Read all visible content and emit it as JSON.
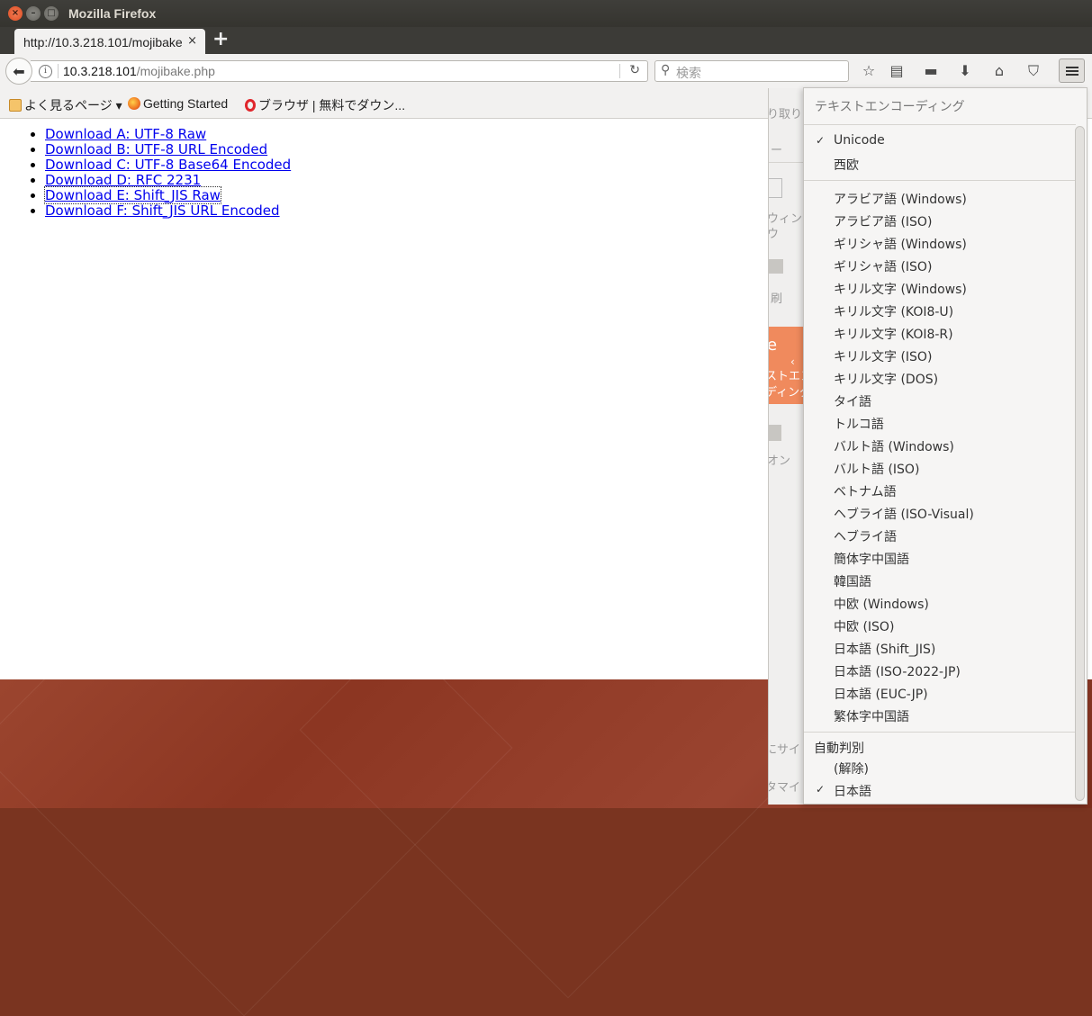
{
  "window": {
    "title": "Mozilla Firefox"
  },
  "tab": {
    "label": "http://10.3.218.101/mojibake.php",
    "close": "×",
    "new": "+"
  },
  "navbar": {
    "url_host": "10.3.218.101",
    "url_path": "/mojibake.php",
    "search_placeholder": "検索"
  },
  "bookmarks": [
    {
      "label": "よく見るページ ▾",
      "icon": "folder-icon"
    },
    {
      "label": "Getting Started",
      "icon": "firefox-icon"
    },
    {
      "label": "ブラウザ | 無料でダウン...",
      "icon": "opera-icon"
    }
  ],
  "page": {
    "links": [
      "Download A: UTF-8 Raw",
      "Download B: UTF-8 URL Encoded",
      "Download C: UTF-8 Base64 Encoded",
      "Download D: RFC 2231",
      "Download E: Shift_JIS Raw",
      "Download F: Shift_JIS URL Encoded"
    ]
  },
  "sidepanel": {
    "t1": "り取り",
    "t2": "ー",
    "t3": "ウィンド",
    "t4": "ウ",
    "t5": "刷",
    "t6": "e",
    "t7": "ストエン",
    "t8": "ディング",
    "t9": "オン",
    "t10": "にサイ",
    "t11": "タマイ"
  },
  "encoding_menu": {
    "header": "テキストエンコーディング",
    "top": [
      {
        "label": "Unicode",
        "checked": true
      },
      {
        "label": "西欧",
        "checked": false
      }
    ],
    "list": [
      "アラビア語 (Windows)",
      "アラビア語 (ISO)",
      "ギリシャ語 (Windows)",
      "ギリシャ語 (ISO)",
      "キリル文字 (Windows)",
      "キリル文字 (KOI8-U)",
      "キリル文字 (KOI8-R)",
      "キリル文字 (ISO)",
      "キリル文字 (DOS)",
      "タイ語",
      "トルコ語",
      "バルト語 (Windows)",
      "バルト語 (ISO)",
      "ベトナム語",
      "ヘブライ語 (ISO-Visual)",
      "ヘブライ語",
      "簡体字中国語",
      "韓国語",
      "中欧 (Windows)",
      "中欧 (ISO)",
      "日本語 (Shift_JIS)",
      "日本語 (ISO-2022-JP)",
      "日本語 (EUC-JP)",
      "繁体字中国語"
    ],
    "autodetect": {
      "label": "自動判別",
      "options": [
        {
          "label": "(解除)",
          "checked": false
        },
        {
          "label": "日本語",
          "checked": true
        }
      ]
    },
    "check_mark": "✓"
  }
}
